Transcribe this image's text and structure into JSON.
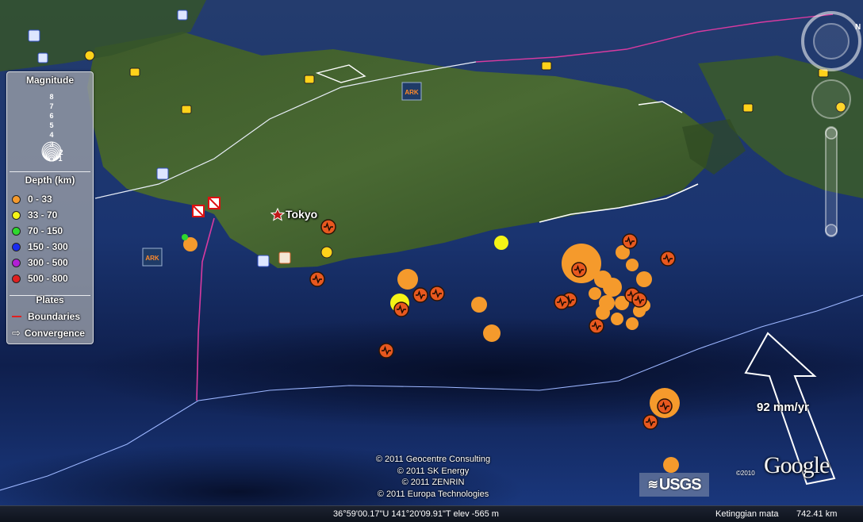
{
  "map": {
    "city": "Tokyo",
    "plate_rate": "92 mm/yr",
    "copyrights": [
      "© 2011 Geocentre Consulting",
      "© 2011 SK Energy",
      "© 2011 ZENRIN",
      "© 2011 Europa Technologies"
    ],
    "logo_usgs": "USGS",
    "logo_google": "Google",
    "google_year": "©2010"
  },
  "legend": {
    "magnitude_title": "Magnitude",
    "magnitudes": [
      "8",
      "7",
      "6",
      "5",
      "4",
      "3",
      "2",
      "1"
    ],
    "depth_title": "Depth (km)",
    "depth_items": [
      {
        "label": "0 - 33",
        "color": "#f59a2c"
      },
      {
        "label": "33 - 70",
        "color": "#f4f416"
      },
      {
        "label": "70 - 150",
        "color": "#2ed82e"
      },
      {
        "label": "150 - 300",
        "color": "#1a2cf0"
      },
      {
        "label": "300 - 500",
        "color": "#b21fd6"
      },
      {
        "label": "500 - 800",
        "color": "#e02020"
      }
    ],
    "plates_title": "Plates",
    "plates_items": [
      "Boundaries",
      "Convergence"
    ]
  },
  "status": {
    "coordinates": "36°59'00.17\"U 141°20'09.91\"T  elev -565 m",
    "eye_alt_label": "Ketinggian mata",
    "eye_alt_value": "742.41 km"
  },
  "colors": {
    "shallow": "#f59a2c",
    "intermediate": "#f4f416",
    "boundary": "#e02020",
    "ocean": "#16306b"
  },
  "icons": [
    "earthquake-icon",
    "camera-icon",
    "panoramio-icon",
    "ark-icon",
    "star-icon",
    "compass-icon",
    "zoom-slider-icon"
  ]
}
